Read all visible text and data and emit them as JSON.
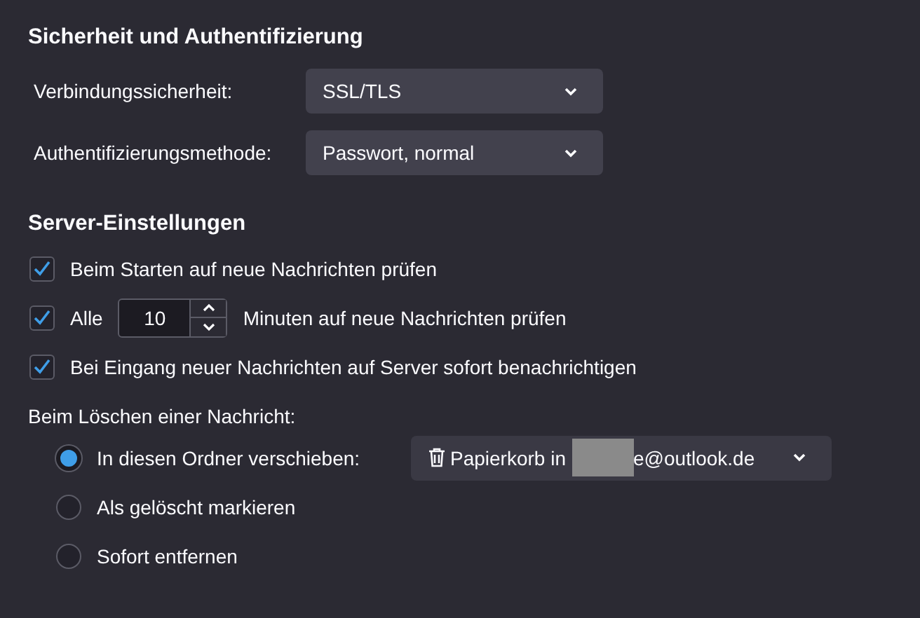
{
  "security": {
    "heading": "Sicherheit und Authentifizierung",
    "fields": [
      {
        "label": "Verbindungssicherheit:",
        "value": "SSL/TLS"
      },
      {
        "label": "Authentifizierungsmethode:",
        "value": "Passwort, normal"
      }
    ]
  },
  "server": {
    "heading": "Server-Einstellungen",
    "options": [
      {
        "kind": "checkbox",
        "label": "Beim Starten auf neue Nachrichten prüfen",
        "checked": true
      },
      {
        "kind": "interval",
        "label": "Alle",
        "value": "10",
        "suffix": "Minuten auf neue Nachrichten prüfen",
        "checked": true
      },
      {
        "kind": "checkbox",
        "label": "Bei Eingang neuer Nachrichten auf Server sofort benachrichtigen",
        "checked": true
      }
    ]
  },
  "delete": {
    "label": "Beim Löschen einer Nachricht:",
    "choices": [
      {
        "label": "In diesen Ordner verschieben:",
        "selected": true,
        "folder": {
          "prefix": "Papierkorb in",
          "redacted": true,
          "suffix": "e@outlook.de"
        }
      },
      {
        "label": "Als gelöscht markieren",
        "selected": false
      },
      {
        "label": "Sofort entfernen",
        "selected": false
      }
    ]
  }
}
